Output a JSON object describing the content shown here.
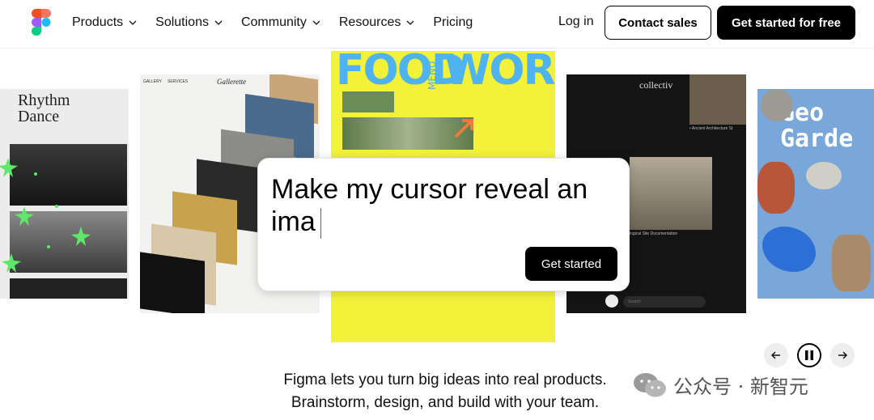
{
  "nav": {
    "items": [
      {
        "label": "Products",
        "has_menu": true
      },
      {
        "label": "Solutions",
        "has_menu": true
      },
      {
        "label": "Community",
        "has_menu": true
      },
      {
        "label": "Resources",
        "has_menu": true
      },
      {
        "label": "Pricing",
        "has_menu": false
      }
    ],
    "login_label": "Log in",
    "contact_label": "Contact sales",
    "get_started_label": "Get started for free"
  },
  "carousel": {
    "cards": [
      {
        "title_line1": "Rhythm",
        "title_line2": "Dance"
      },
      {
        "menu1": "GALLERY",
        "menu2": "SERVICES",
        "brand": "Gallerette"
      },
      {
        "title_left": "FOOD",
        "title_mid": "MENU",
        "title_right": "WORKS"
      },
      {
        "brand": "collectiv",
        "caption1": "• Ancient Architecture St",
        "caption2": "logical Site Documentation",
        "search_placeholder": "Search"
      },
      {
        "title_line1": "Geo",
        "title_line2": "Garde"
      }
    ]
  },
  "prompt": {
    "text": "Make my cursor reveal an ima",
    "button_label": "Get started"
  },
  "controls": {
    "prev_icon": "arrow-left-icon",
    "pause_icon": "pause-icon",
    "next_icon": "arrow-right-icon"
  },
  "tagline": {
    "line1": "Figma lets you turn big ideas into real products.",
    "line2": "Brainstorm, design, and build with your team."
  },
  "watermark": {
    "text": "公众号 · 新智元"
  },
  "colors": {
    "food_card_bg": "#f2f23a",
    "food_title": "#4fb3ef",
    "accent_green": "#5ee86a",
    "button_dark": "#000000"
  }
}
